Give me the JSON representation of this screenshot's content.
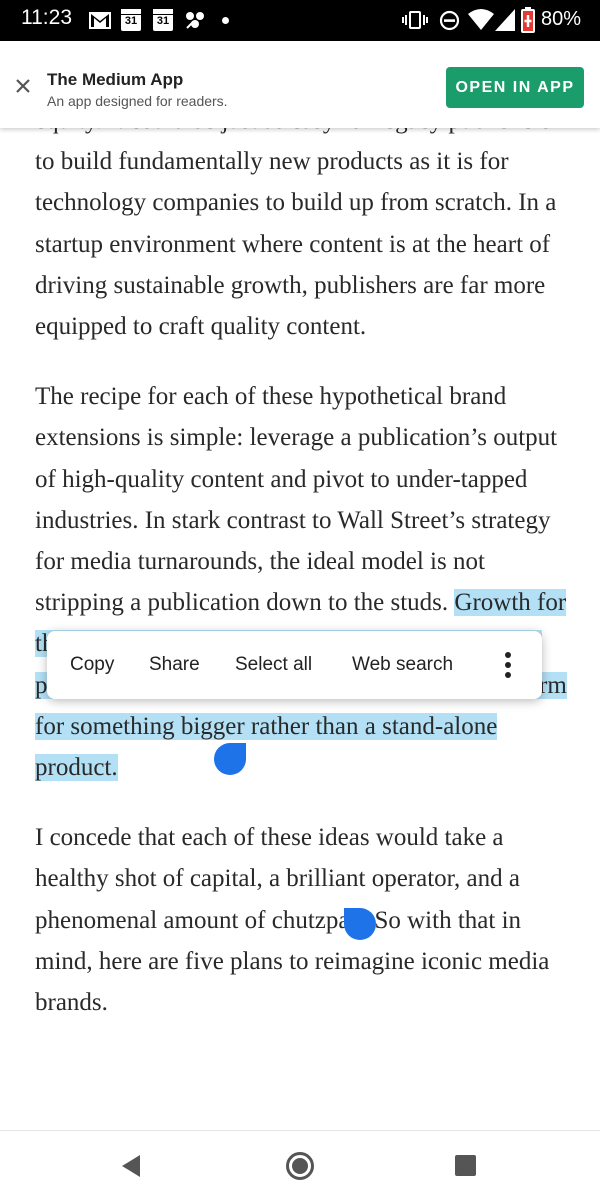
{
  "status_bar": {
    "time": "11:23",
    "calendar_1": "31",
    "calendar_2": "31",
    "battery": "80%",
    "icons": [
      "gmail-icon",
      "calendar-icon",
      "calendar-icon",
      "pinwheel-icon",
      "notification-dot",
      "vibrate-icon",
      "do-not-disturb-icon",
      "wifi-icon",
      "signal-icon",
      "battery-icon"
    ]
  },
  "banner": {
    "title": "The Medium App",
    "subtitle": "An app designed for readers.",
    "button": "OPEN IN APP",
    "accent": "#1a9c6b"
  },
  "article": {
    "partial_line": "equity. It could be just as easy for legacy",
    "para1": "publishers to build fundamentally new products as it is for technology companies to build up from scratch. In a startup environment where content is at the heart of driving sustainable growth, publishers are far more equipped to craft quality content.",
    "para2_before": "The recipe for each of these hypothetical brand extensions is simple: leverage a publication’s output of high-quality content and pivot to under-tapped industries. In stark contrast to Wall Street’s strategy for media turnarounds, the ideal model is not stripping a publication down to the studs. ",
    "para2_selected": "Growth for these new businesses would only be possible if the publication thrives, albeit as a content marketing arm for something bigger rather than a stand-alone product.",
    "para3": "I concede that each of these ideas would take a healthy shot of capital, a brilliant operator, and a phenomenal amount of chutzpah. So with that in mind, here are five plans to reimagine iconic media brands.",
    "selection_color": "#b3e0f5"
  },
  "context_menu": {
    "copy": "Copy",
    "share": "Share",
    "select_all": "Select all",
    "web_search": "Web search"
  },
  "nav_bar": {
    "icons": [
      "back-icon",
      "home-icon",
      "recents-icon"
    ]
  }
}
